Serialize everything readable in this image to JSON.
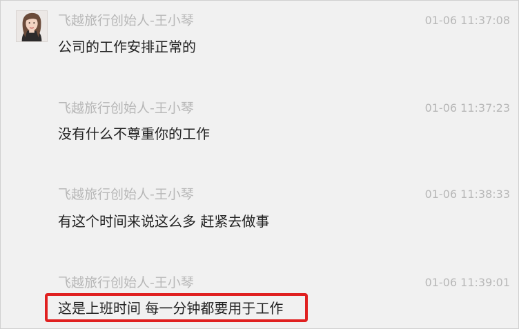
{
  "messages": [
    {
      "sender": "飞越旅行创始人-王小琴",
      "time": "01-06 11:37:08",
      "text": "公司的工作安排正常的"
    },
    {
      "sender": "飞越旅行创始人-王小琴",
      "time": "01-06 11:37:23",
      "text": "没有什么不尊重你的工作"
    },
    {
      "sender": "飞越旅行创始人-王小琴",
      "time": "01-06 11:38:33",
      "text": "有这个时间来说这么多 赶紧去做事"
    },
    {
      "sender": "飞越旅行创始人-王小琴",
      "time": "01-06 11:39:01",
      "text": "这是上班时间 每一分钟都要用于工作"
    }
  ],
  "colors": {
    "background": "#f1f1f1",
    "meta_text": "#b7b7b7",
    "message_text": "#222222",
    "highlight": "#e02020"
  }
}
